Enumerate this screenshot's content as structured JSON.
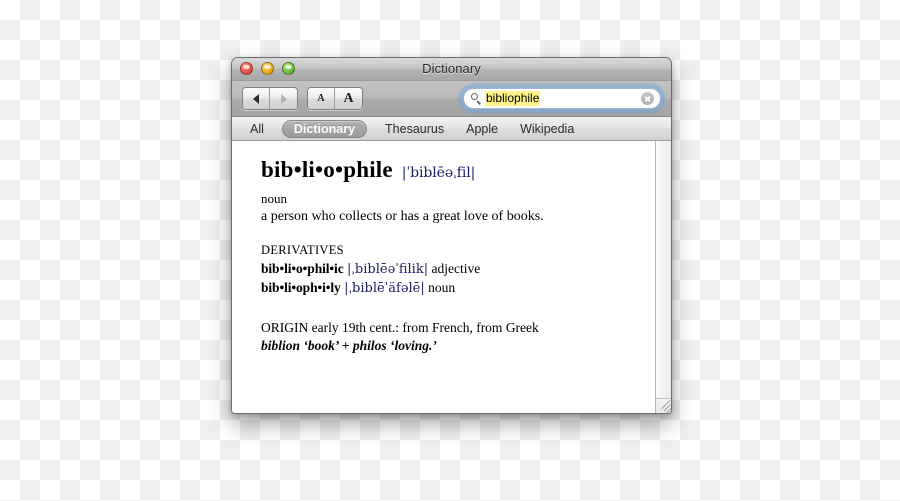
{
  "window": {
    "title": "Dictionary",
    "traffic_lights": [
      "close-button",
      "minimize-button",
      "zoom-button"
    ]
  },
  "toolbar": {
    "back_icon": "triangle-left-icon",
    "forward_icon": "triangle-right-icon",
    "font_smaller_label": "A",
    "font_larger_label": "A",
    "search": {
      "value": "bibliophile",
      "placeholder": "Search",
      "icon": "search-icon",
      "clear_icon": "clear-circle-icon",
      "highlight_color": "#fff38a",
      "focus_ring_color": "#70aae2"
    }
  },
  "sources": {
    "items": [
      {
        "label": "All",
        "active": false
      },
      {
        "label": "Dictionary",
        "active": true
      },
      {
        "label": "Thesaurus",
        "active": false
      },
      {
        "label": "Apple",
        "active": false
      },
      {
        "label": "Wikipedia",
        "active": false
      }
    ]
  },
  "entry": {
    "headword": "bib•li•o•phile",
    "pronunciation": "|ˈbiblēəˌfil|",
    "part_of_speech": "noun",
    "definition": "a person who collects or has a great love of books.",
    "derivatives_heading": "DERIVATIVES",
    "derivatives": [
      {
        "word": "bib•li•o•phil•ic",
        "pronunciation": "|ˌbiblēəˈfilik|",
        "part_of_speech": "adjective"
      },
      {
        "word": "bib•li•oph•i•ly",
        "pronunciation": "|ˌbiblēˈäfəlē|",
        "part_of_speech": "noun"
      }
    ],
    "origin_label": "ORIGIN",
    "origin_text": "early 19th cent.: from French, from Greek",
    "origin_etymology": "biblion ‘book’ + philos ‘loving.’"
  }
}
